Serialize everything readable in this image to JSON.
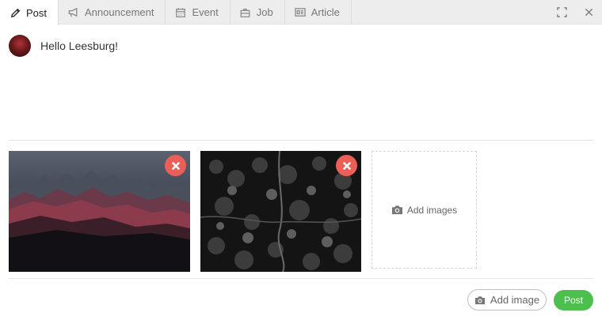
{
  "tabs": [
    {
      "label": "Post",
      "icon": "pencil-icon",
      "active": true
    },
    {
      "label": "Announcement",
      "icon": "megaphone-icon",
      "active": false
    },
    {
      "label": "Event",
      "icon": "calendar-icon",
      "active": false
    },
    {
      "label": "Job",
      "icon": "briefcase-icon",
      "active": false
    },
    {
      "label": "Article",
      "icon": "newspaper-icon",
      "active": false
    }
  ],
  "tools": {
    "expand_icon": "expand-icon",
    "close_icon": "close-icon"
  },
  "composer": {
    "text": "Hello Leesburg!"
  },
  "gallery": {
    "images": [
      {
        "subject": "mountains",
        "remove_icon": "remove-icon"
      },
      {
        "subject": "forest-aerial",
        "remove_icon": "remove-icon"
      }
    ],
    "add_images_label": "Add images"
  },
  "footer": {
    "add_image_label": "Add image",
    "post_label": "Post"
  },
  "colors": {
    "accent_green": "#4cbf4f",
    "remove_red": "#ec5e58",
    "tab_bg": "#ededed"
  }
}
